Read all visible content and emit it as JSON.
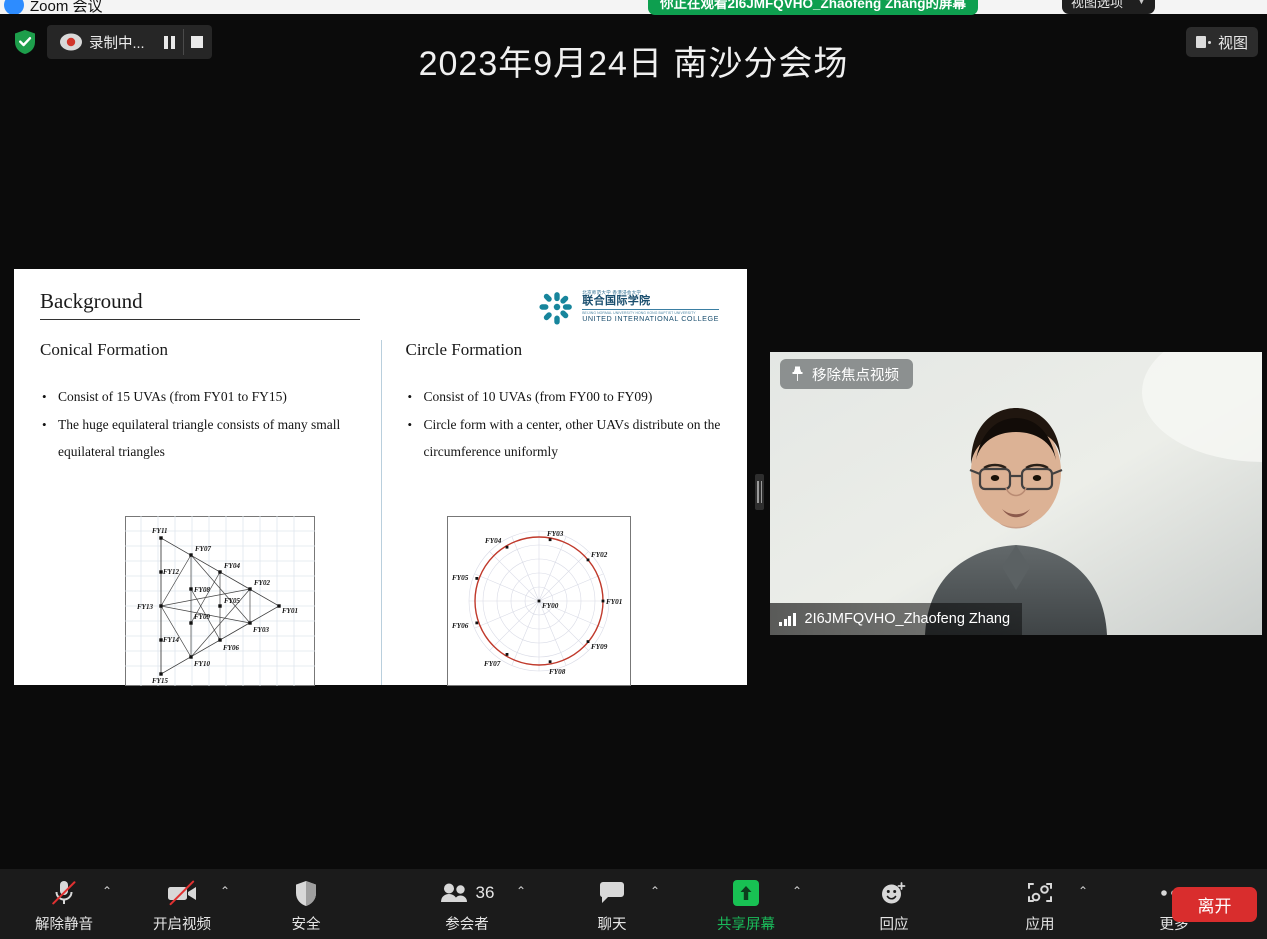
{
  "window": {
    "app_title": "Zoom 会议",
    "logo_icon": "zoom-logo-icon"
  },
  "share_banner": {
    "text": "你正在观看2I6JMFQVHO_Zhaofeng Zhang的屏幕",
    "view_options_label": "视图选项",
    "chevron_icon": "chevron-down-icon",
    "color": "#0e9f4f"
  },
  "recording": {
    "shield_icon": "security-shield-icon",
    "record_icon": "recording-dot-icon",
    "label": "录制中...",
    "pause_icon": "pause-icon",
    "stop_icon": "stop-icon"
  },
  "topic": "2023年9月24日 南沙分会场",
  "view_button": {
    "label": "视图",
    "icon": "layout-view-icon"
  },
  "slide": {
    "title": "Background",
    "logo": {
      "cn_small": "北京师范大学 香港浸会大学",
      "cn_big": "联合国际学院",
      "en_small": "BEIJING NORMAL UNIVERSITY  HONG KONG BAPTIST UNIVERSITY",
      "en_big": "UNITED INTERNATIONAL COLLEGE",
      "mark_icon": "uic-snowflake-logo-icon"
    },
    "columns": [
      {
        "heading": "Conical Formation",
        "bullets": [
          "Consist of 15 UVAs (from FY01 to FY15)",
          "The huge equilateral triangle consists of many small equilateral triangles"
        ],
        "figure_name": "conical-formation-diagram",
        "figure_labels": [
          "FY11",
          "FY07",
          "FY12",
          "FY04",
          "FY08",
          "FY02",
          "FY05",
          "FY13",
          "FY01",
          "FY09",
          "FY03",
          "FY14",
          "FY06",
          "FY10",
          "FY15"
        ]
      },
      {
        "heading": "Circle Formation",
        "bullets": [
          "Consist of 10 UVAs (from FY00 to FY09)",
          "Circle form with a center, other UAVs distribute on the circumference uniformly"
        ],
        "figure_name": "circle-formation-diagram",
        "figure_labels": [
          "FY03",
          "FY04",
          "FY02",
          "FY05",
          "FY01",
          "FY00",
          "FY06",
          "FY09",
          "FY07",
          "FY08"
        ],
        "circle_color": "#c0392b"
      }
    ]
  },
  "video": {
    "pin_label": "移除焦点视频",
    "pin_icon": "pin-icon",
    "participant_name": "2I6JMFQVHO_Zhaofeng Zhang",
    "signal_icon": "signal-bars-icon"
  },
  "toolbar": {
    "items": [
      {
        "label": "解除静音",
        "icon": "microphone-muted-icon",
        "has_caret": true,
        "green": false
      },
      {
        "label": "开启视频",
        "icon": "video-camera-off-icon",
        "has_caret": true,
        "green": false
      },
      {
        "label": "安全",
        "icon": "shield-icon",
        "has_caret": false,
        "green": false
      },
      {
        "label": "参会者",
        "icon": "participants-icon",
        "has_caret": true,
        "green": false,
        "count": "36"
      },
      {
        "label": "聊天",
        "icon": "chat-bubble-icon",
        "has_caret": true,
        "green": false
      },
      {
        "label": "共享屏幕",
        "icon": "share-screen-icon",
        "has_caret": true,
        "green": true
      },
      {
        "label": "回应",
        "icon": "reactions-smiley-icon",
        "has_caret": false,
        "green": false
      },
      {
        "label": "应用",
        "icon": "apps-icon",
        "has_caret": true,
        "green": false
      },
      {
        "label": "更多",
        "icon": "more-dots-icon",
        "has_caret": false,
        "green": false
      }
    ],
    "leave_label": "离开",
    "leave_color": "#d92d2d",
    "share_accent": "#18c153"
  },
  "chart_data": [
    {
      "type": "scatter",
      "title": "Conical Formation",
      "xlabel": "",
      "ylabel": "",
      "grid": true,
      "points": [
        {
          "label": "FY11",
          "x": 0.22,
          "y": 0.88
        },
        {
          "label": "FY07",
          "x": 0.38,
          "y": 0.78
        },
        {
          "label": "FY12",
          "x": 0.28,
          "y": 0.68
        },
        {
          "label": "FY04",
          "x": 0.55,
          "y": 0.66
        },
        {
          "label": "FY08",
          "x": 0.44,
          "y": 0.56
        },
        {
          "label": "FY02",
          "x": 0.7,
          "y": 0.55
        },
        {
          "label": "FY05",
          "x": 0.55,
          "y": 0.47
        },
        {
          "label": "FY13",
          "x": 0.2,
          "y": 0.46
        },
        {
          "label": "FY01",
          "x": 0.82,
          "y": 0.44
        },
        {
          "label": "FY09",
          "x": 0.44,
          "y": 0.4
        },
        {
          "label": "FY03",
          "x": 0.7,
          "y": 0.34
        },
        {
          "label": "FY14",
          "x": 0.28,
          "y": 0.28
        },
        {
          "label": "FY06",
          "x": 0.55,
          "y": 0.27
        },
        {
          "label": "FY10",
          "x": 0.38,
          "y": 0.18
        },
        {
          "label": "FY15",
          "x": 0.22,
          "y": 0.08
        }
      ]
    },
    {
      "type": "scatter",
      "title": "Circle Formation",
      "xlabel": "",
      "ylabel": "",
      "grid": true,
      "polar": true,
      "radius": 1.0,
      "points": [
        {
          "label": "FY00",
          "angle_deg": 0,
          "r": 0
        },
        {
          "label": "FY01",
          "angle_deg": 0,
          "r": 1
        },
        {
          "label": "FY02",
          "angle_deg": 40,
          "r": 1
        },
        {
          "label": "FY03",
          "angle_deg": 80,
          "r": 1
        },
        {
          "label": "FY04",
          "angle_deg": 120,
          "r": 1
        },
        {
          "label": "FY05",
          "angle_deg": 160,
          "r": 1
        },
        {
          "label": "FY06",
          "angle_deg": 200,
          "r": 1
        },
        {
          "label": "FY07",
          "angle_deg": 240,
          "r": 1
        },
        {
          "label": "FY08",
          "angle_deg": 280,
          "r": 1
        },
        {
          "label": "FY09",
          "angle_deg": 320,
          "r": 1
        }
      ]
    }
  ]
}
